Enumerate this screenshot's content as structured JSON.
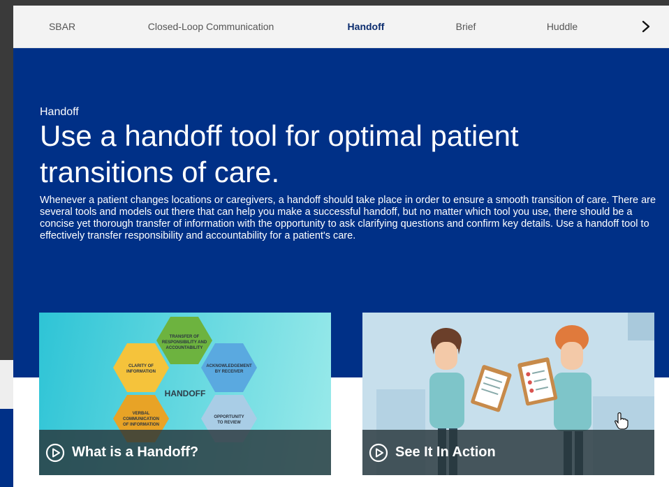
{
  "tabs": [
    {
      "label": "SBAR",
      "active": false
    },
    {
      "label": "Closed-Loop Communication",
      "active": false
    },
    {
      "label": "Handoff",
      "active": true
    },
    {
      "label": "Brief",
      "active": false
    },
    {
      "label": "Huddle",
      "active": false
    }
  ],
  "hero": {
    "eyebrow": "Handoff",
    "headline": "Use a handoff tool for optimal patient transitions of care.",
    "body": "Whenever a patient changes locations or caregivers, a handoff should take place in order to ensure a smooth transition of care. There are several tools and models out there that can help you make a successful handoff, but no matter which tool you use, there should be a concise yet thorough transfer of information with the opportunity to ask clarifying questions and confirm key details. Use a handoff tool to effectively transfer responsibility and accountability for a patient's care."
  },
  "cards": [
    {
      "label": "What is a Handoff?",
      "diagram": {
        "center": "HANDOFF",
        "hexes": [
          [
            "TRANSFER OF",
            "RESPONSIBILITY AND",
            "ACCOUNTABILITY"
          ],
          [
            "CLARITY OF",
            "INFORMATION"
          ],
          [
            "ACKNOWLEDGEMENT",
            "BY RECEIVER"
          ],
          [
            "VERBAL",
            "COMMUNICATION",
            "OF INFORMATION"
          ],
          [
            "OPPORTUNITY",
            "TO REVIEW"
          ]
        ]
      }
    },
    {
      "label": "See It In Action"
    }
  ],
  "colors": {
    "hero_bg": "#003087",
    "active_tab": "#0b2c6e"
  },
  "icons": {
    "next": "chevron-right-icon",
    "play": "play-circle-icon",
    "cursor": "hand-pointer-icon"
  }
}
